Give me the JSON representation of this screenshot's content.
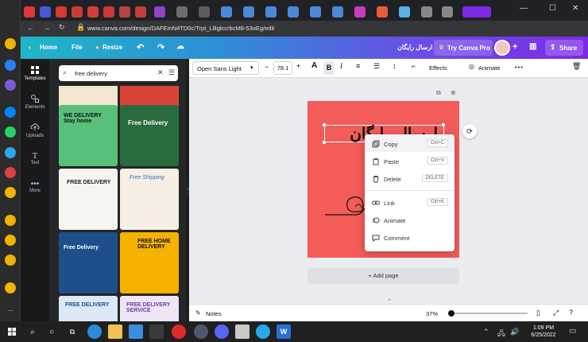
{
  "browser": {
    "address": "www.canva.com/design/DAFEmN4TD0c/Trpt_LBglccrbcM8-53oEg/edit",
    "tab_texts": [
      "P",
      "C",
      "X",
      "C",
      "S",
      "E",
      "n",
      "X",
      "S",
      "S",
      "S",
      "3",
      "C",
      "9",
      "S",
      "5",
      "S",
      "In"
    ],
    "window_controls": [
      "minimize",
      "maximize",
      "close"
    ]
  },
  "topbar": {
    "home": "Home",
    "file": "File",
    "resize": "Resize",
    "send_free": "ارسال رایگان",
    "try_pro": "Try Canva Pro",
    "share": "Share"
  },
  "rail": [
    {
      "label": "Templates",
      "icon": "templates-icon"
    },
    {
      "label": "Elements",
      "icon": "elements-icon"
    },
    {
      "label": "Uploads",
      "icon": "uploads-icon"
    },
    {
      "label": "Text",
      "icon": "text-icon"
    },
    {
      "label": "More",
      "icon": "more-icon"
    }
  ],
  "panel": {
    "search_value": "free delivery",
    "thumbnails": [
      {
        "text": "",
        "bg": "#f3e7d3",
        "accent": "#e04a2e"
      },
      {
        "text": "",
        "bg": "#d6443a",
        "accent": "#f0c040"
      },
      {
        "text": "WE DELIVERY\nStay home",
        "bg": "#58c07a",
        "accent": "#1a1a1a"
      },
      {
        "text": "Free Delivery",
        "bg": "#2a6b3d",
        "accent": "#ffffff"
      },
      {
        "text": "FREE DELIVERY",
        "bg": "#f7f5f0",
        "accent": "#222222"
      },
      {
        "text": "Free Shipping",
        "bg": "#f6efe3",
        "accent": "#3b6cc4"
      },
      {
        "text": "Free Delivery",
        "bg": "#1e4f8a",
        "accent": "#ffffff"
      },
      {
        "text": "FREE HOME DELIVERY",
        "bg": "#f5b200",
        "accent": "#1a1a1a"
      },
      {
        "text": "FREE DELIVERY",
        "bg": "#dbe9f7",
        "accent": "#1e4f8a"
      },
      {
        "text": "FREE DELIVERY SERVICE",
        "bg": "#efe6f5",
        "accent": "#6a3e9e"
      }
    ]
  },
  "toolbar": {
    "font": "Open Sans Light",
    "size": "78.1",
    "minus": "−",
    "plus": "+",
    "effects": "Effects",
    "animate": "Animate",
    "more": "•••"
  },
  "canvas": {
    "text": "ارسال رایگان",
    "bg": "#f35c59",
    "add_page": "+ Add page"
  },
  "context_menu": [
    {
      "label": "Copy",
      "shortcut": "Ctrl+C",
      "icon": "copy-icon"
    },
    {
      "label": "Paste",
      "shortcut": "Ctrl+V",
      "icon": "paste-icon"
    },
    {
      "label": "Delete",
      "shortcut": "DELETE",
      "icon": "delete-icon"
    },
    {
      "label": "Link",
      "shortcut": "Ctrl+K",
      "icon": "link-icon"
    },
    {
      "label": "Animate",
      "shortcut": "",
      "icon": "animate-icon"
    },
    {
      "label": "Comment",
      "shortcut": "",
      "icon": "comment-icon"
    }
  ],
  "bottom": {
    "notes": "Notes",
    "zoom": "37%",
    "zoom_fraction": 0.37
  },
  "taskbar": {
    "time": "1:09 PM",
    "date": "6/25/2022"
  },
  "colors": {
    "accent": "#7d2ae8",
    "canvas": "#f35c59",
    "menu_highlight": "#f1f3f6"
  }
}
